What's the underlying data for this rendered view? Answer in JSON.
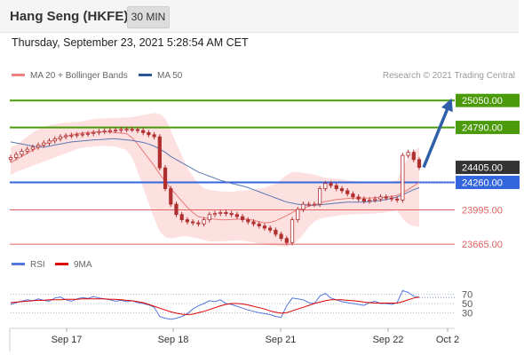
{
  "header": {
    "title": "Hang Seng (HKFE)",
    "timeframe": "30 MIN",
    "timestamp": "Thursday, September 23, 2021 5:28:54 AM CET"
  },
  "legend": {
    "bollinger_label": "MA 20 + Bollinger Bands",
    "bollinger_color": "#f08080",
    "ma50_label": "MA 50",
    "ma50_color": "#2b5797",
    "credit": "Research © 2021 Trading Central"
  },
  "chart_data": [
    {
      "type": "candlestick",
      "title": "Hang Seng (HKFE)",
      "timeframe": "30 MIN",
      "ylim": [
        23580,
        25180
      ],
      "x_tick_labels": [
        "Sep 17",
        "Sep 18",
        "Sep 21",
        "Sep 22",
        "Oct 2"
      ],
      "levels": [
        {
          "value": 25050,
          "label": "25050.00",
          "color": "#4a9a0a",
          "kind": "resistance"
        },
        {
          "value": 24790,
          "label": "24790.00",
          "color": "#4a9a0a",
          "kind": "resistance"
        },
        {
          "value": 24405,
          "label": "24405.00",
          "color": "#333333",
          "kind": "last price"
        },
        {
          "value": 24260,
          "label": "24260.00",
          "color": "#3366dd",
          "kind": "pivot"
        },
        {
          "value": 23995,
          "label": "23995.00",
          "color": "#e06060",
          "kind": "support"
        },
        {
          "value": 23665,
          "label": "23665.00",
          "color": "#e06060",
          "kind": "support"
        }
      ],
      "series": [
        {
          "name": "Price",
          "close": [
            24500,
            24530,
            24560,
            24580,
            24600,
            24620,
            24640,
            24660,
            24680,
            24700,
            24710,
            24715,
            24720,
            24725,
            24730,
            24740,
            24750,
            24755,
            24760,
            24765,
            24770,
            24772,
            24770,
            24760,
            24740,
            24720,
            24700,
            24400,
            24200,
            24050,
            23950,
            23900,
            23880,
            23870,
            23860,
            23900,
            23950,
            23960,
            23970,
            23960,
            23950,
            23930,
            23900,
            23880,
            23860,
            23840,
            23820,
            23800,
            23760,
            23720,
            23680,
            23900,
            24000,
            24050,
            24050,
            24050,
            24200,
            24250,
            24230,
            24200,
            24180,
            24150,
            24120,
            24100,
            24080,
            24090,
            24100,
            24120,
            24110,
            24100,
            24090,
            24520,
            24550,
            24480,
            24405
          ]
        },
        {
          "name": "MA 20 + Bollinger Bands",
          "middle": [
            24450,
            24480,
            24510,
            24540,
            24570,
            24600,
            24625,
            24650,
            24670,
            24690,
            24705,
            24718,
            24728,
            24735,
            24740,
            24745,
            24748,
            24748,
            24745,
            24740,
            24735,
            24730,
            24690,
            24630,
            24560,
            24490,
            24420,
            24340,
            24270,
            24200,
            24140,
            24080,
            24020,
            23970,
            23930,
            23920,
            23910,
            23905,
            23900,
            23900,
            23902,
            23905,
            23907,
            23905,
            23895,
            23880,
            23870,
            23875,
            23890,
            23915,
            23940,
            23970,
            23995,
            24010,
            24030,
            24045,
            24060,
            24075,
            24085,
            24095,
            24100,
            24105,
            24108,
            24110,
            24110,
            24110,
            24112,
            24115,
            24120,
            24125,
            24135,
            24160,
            24190,
            24225,
            24260
          ],
          "upper": [
            24600,
            24620,
            24660,
            24700,
            24740,
            24770,
            24790,
            24810,
            24820,
            24830,
            24835,
            24840,
            24845,
            24850,
            24860,
            24870,
            24875,
            24878,
            24880,
            24880,
            24885,
            24885,
            24890,
            24900,
            24910,
            24920,
            24930,
            24920,
            24880,
            24760,
            24640,
            24520,
            24400,
            24320,
            24250,
            24200,
            24190,
            24180,
            24175,
            24170,
            24170,
            24175,
            24180,
            24185,
            24190,
            24200,
            24210,
            24230,
            24250,
            24290,
            24330,
            24360,
            24360,
            24350,
            24345,
            24335,
            24320,
            24305,
            24300,
            24295,
            24290,
            24280,
            24275,
            24270,
            24265,
            24262,
            24260,
            24262,
            24265,
            24270,
            24280,
            24400,
            24500,
            24560,
            24600
          ],
          "lower": [
            24330,
            24360,
            24380,
            24400,
            24420,
            24440,
            24460,
            24480,
            24500,
            24520,
            24540,
            24560,
            24580,
            24595,
            24600,
            24605,
            24610,
            24612,
            24610,
            24605,
            24590,
            24570,
            24500,
            24360,
            24210,
            24060,
            23910,
            23790,
            23730,
            23720,
            23730,
            23740,
            23740,
            23730,
            23720,
            23705,
            23690,
            23690,
            23690,
            23695,
            23700,
            23700,
            23698,
            23690,
            23680,
            23670,
            23660,
            23655,
            23650,
            23645,
            23640,
            23660,
            23700,
            23760,
            23830,
            23880,
            23910,
            23920,
            23930,
            23938,
            23945,
            23950,
            23953,
            23955,
            23955,
            23958,
            23960,
            23965,
            23972,
            23980,
            23990,
            23910,
            23860,
            23840,
            23830
          ]
        },
        {
          "name": "MA 50",
          "values": [
            24650,
            24640,
            24630,
            24620,
            24610,
            24600,
            24600,
            24610,
            24620,
            24630,
            24640,
            24650,
            24655,
            24660,
            24665,
            24670,
            24672,
            24675,
            24680,
            24680,
            24675,
            24670,
            24665,
            24655,
            24645,
            24630,
            24610,
            24580,
            24550,
            24510,
            24480,
            24450,
            24420,
            24390,
            24360,
            24340,
            24320,
            24300,
            24280,
            24265,
            24250,
            24238,
            24225,
            24210,
            24190,
            24170,
            24150,
            24130,
            24110,
            24090,
            24070,
            24060,
            24050,
            24045,
            24040,
            24040,
            24045,
            24050,
            24055,
            24060,
            24065,
            24070,
            24070,
            24070,
            24070,
            24075,
            24080,
            24085,
            24095,
            24105,
            24120,
            24140,
            24165,
            24190,
            24210
          ]
        }
      ],
      "forecast": {
        "from": 24405,
        "to": 25050
      }
    },
    {
      "type": "line",
      "title": "RSI",
      "ylim": [
        0,
        100
      ],
      "reference_levels": [
        70,
        50,
        30
      ],
      "series": [
        {
          "name": "RSI",
          "values": [
            48,
            52,
            55,
            58,
            56,
            60,
            57,
            55,
            62,
            64,
            58,
            55,
            60,
            63,
            61,
            65,
            62,
            60,
            58,
            55,
            57,
            54,
            56,
            52,
            50,
            47,
            42,
            22,
            18,
            16,
            18,
            22,
            28,
            38,
            45,
            50,
            56,
            54,
            58,
            50,
            48,
            44,
            40,
            36,
            33,
            30,
            28,
            26,
            22,
            20,
            45,
            62,
            60,
            58,
            52,
            50,
            66,
            72,
            62,
            58,
            54,
            52,
            50,
            48,
            46,
            52,
            55,
            50,
            50,
            48,
            52,
            78,
            74,
            66,
            63
          ]
        },
        {
          "name": "9MA",
          "values": [
            52,
            53,
            54,
            55,
            56,
            57,
            57,
            58,
            58,
            58,
            59,
            59,
            59,
            60,
            60,
            60,
            60,
            60,
            59,
            59,
            58,
            57,
            56,
            54,
            52,
            48,
            44,
            40,
            36,
            32,
            29,
            27,
            26,
            27,
            30,
            33,
            37,
            41,
            45,
            48,
            50,
            50,
            49,
            47,
            44,
            41,
            38,
            34,
            31,
            29,
            30,
            34,
            38,
            42,
            46,
            50,
            53,
            56,
            58,
            58,
            58,
            57,
            56,
            55,
            53,
            52,
            51,
            51,
            51,
            51,
            51,
            54,
            58,
            62,
            64
          ]
        }
      ]
    }
  ]
}
